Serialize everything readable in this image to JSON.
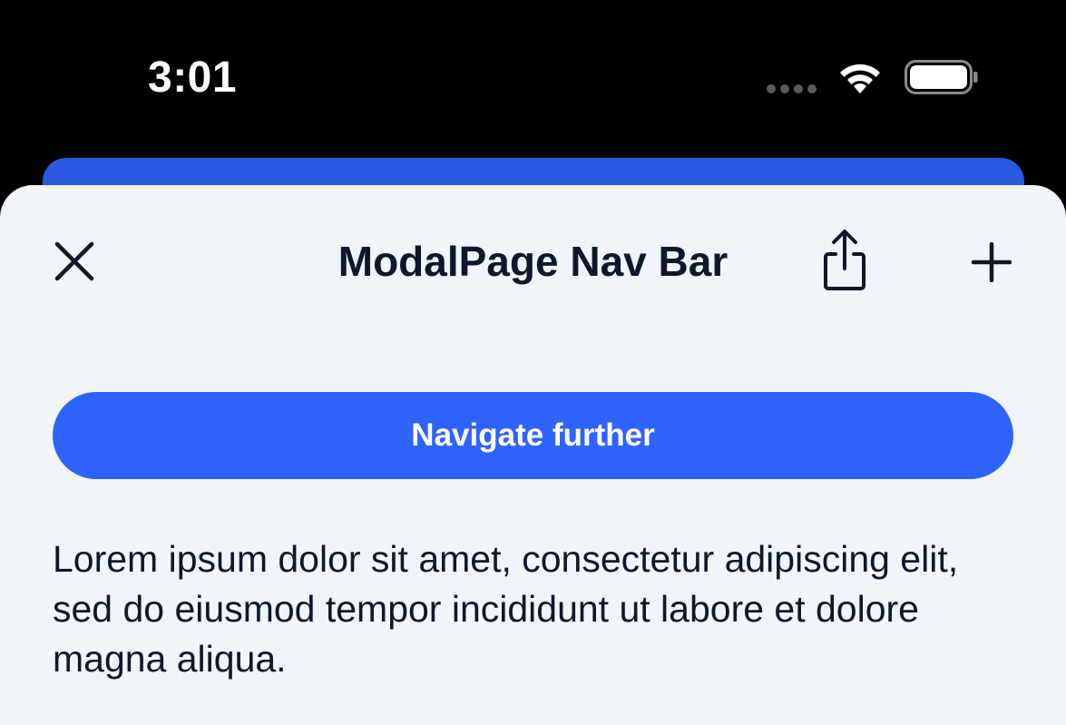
{
  "status_bar": {
    "time": "3:01",
    "wifi_icon": "wifi-icon",
    "battery_icon": "battery-icon",
    "cellular_icon": "cellular-dots-icon"
  },
  "colors": {
    "accent": "#2e63fe",
    "background_card": "#2a59e0",
    "sheet": "#f1f5f9",
    "text": "#0f172a"
  },
  "nav_bar": {
    "title": "ModalPage Nav Bar",
    "close_icon": "close-icon",
    "share_icon": "share-icon",
    "add_icon": "plus-icon"
  },
  "main": {
    "navigate_button_label": "Navigate further",
    "body_text": "Lorem ipsum dolor sit amet, consectetur adipiscing elit, sed do eiusmod tempor incididunt ut labore et dolore magna aliqua."
  }
}
